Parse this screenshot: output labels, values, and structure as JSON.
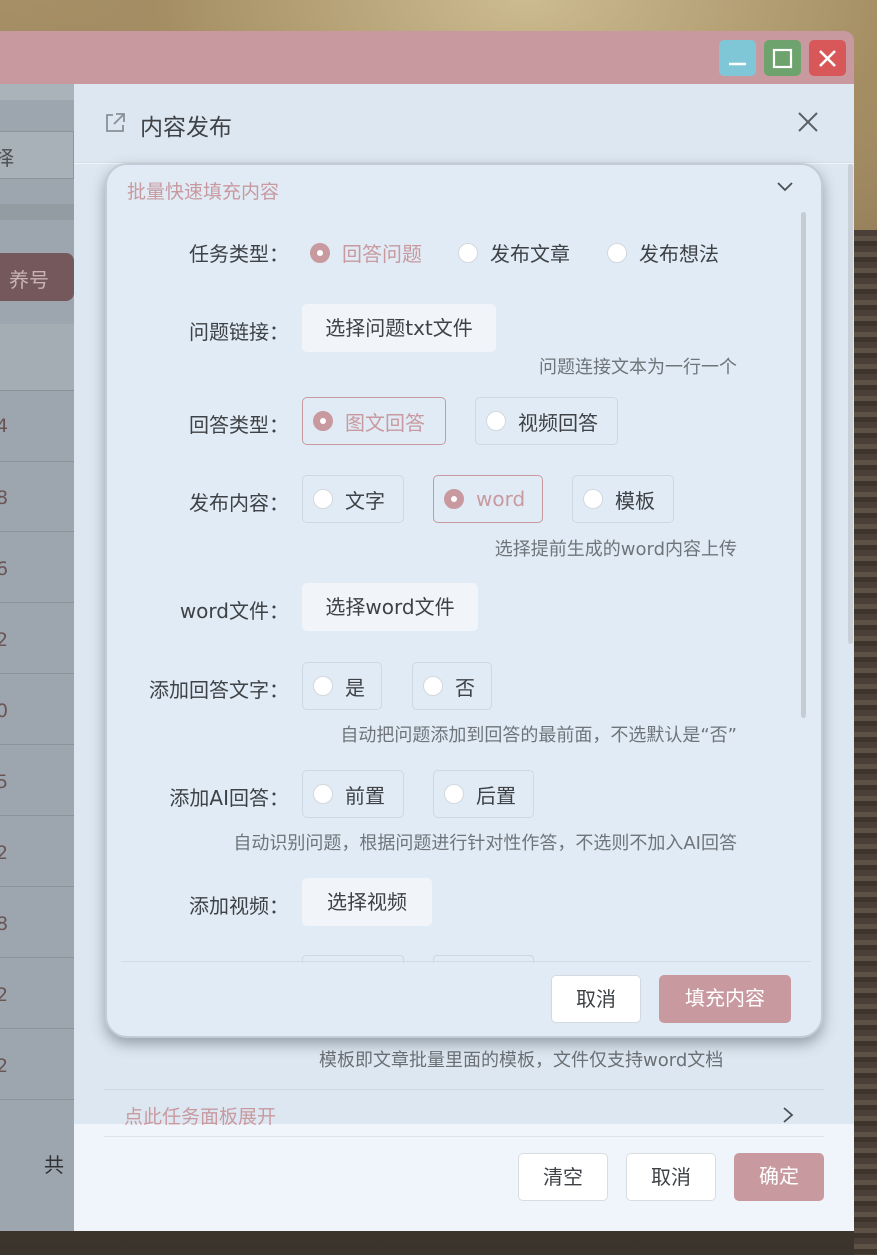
{
  "window_controls": {
    "minimize": "minimize",
    "maximize": "maximize",
    "close": "close"
  },
  "background_app": {
    "select_partial": "择",
    "tag_partial": "养号",
    "row_values": [
      "4",
      "8",
      "6",
      "2",
      "0",
      "5",
      "2",
      "8",
      "2",
      "2"
    ],
    "total_partial": "共"
  },
  "panel": {
    "title": "内容发布",
    "template_hint": "模板即文章批量里面的模板，文件仅支持word文档",
    "expand_label": "点此任务面板展开",
    "buttons": {
      "clear": "清空",
      "cancel": "取消",
      "confirm": "确定"
    }
  },
  "card": {
    "title": "批量快速填充内容",
    "task_type": {
      "label": "任务类型：",
      "options": [
        {
          "label": "回答问题",
          "checked": true
        },
        {
          "label": "发布文章",
          "checked": false
        },
        {
          "label": "发布想法",
          "checked": false
        }
      ]
    },
    "question_link": {
      "label": "问题链接：",
      "button": "选择问题txt文件",
      "hint": "问题连接文本为一行一个"
    },
    "answer_type": {
      "label": "回答类型：",
      "options": [
        {
          "label": "图文回答",
          "checked": true
        },
        {
          "label": "视频回答",
          "checked": false
        }
      ]
    },
    "publish_content": {
      "label": "发布内容：",
      "options": [
        {
          "label": "文字",
          "checked": false
        },
        {
          "label": "word",
          "checked": true
        },
        {
          "label": "模板",
          "checked": false
        }
      ],
      "hint": "选择提前生成的word内容上传"
    },
    "word_file": {
      "label": "word文件：",
      "button": "选择word文件"
    },
    "add_answer_text": {
      "label": "添加回答文字：",
      "options": [
        {
          "label": "是",
          "checked": false
        },
        {
          "label": "否",
          "checked": false
        }
      ],
      "hint": "自动把问题添加到回答的最前面，不选默认是“否”"
    },
    "add_ai_answer": {
      "label": "添加AI回答：",
      "options": [
        {
          "label": "前置",
          "checked": false
        },
        {
          "label": "后置",
          "checked": false
        }
      ],
      "hint": "自动识别问题，根据问题进行针对性作答，不选则不加入AI回答"
    },
    "add_video": {
      "label": "添加视频：",
      "button": "选择视频"
    },
    "buttons": {
      "cancel": "取消",
      "fill": "填充内容"
    }
  },
  "colors": {
    "accent": "#c89aa0",
    "titlebar": "#c89aa0",
    "minimize": "#7fc6d6",
    "maximize": "#6ea36d",
    "close": "#d8585a"
  },
  "icons": [
    "minimize-icon",
    "maximize-icon",
    "close-icon",
    "external-link-icon",
    "chevron-down-icon",
    "chevron-right-icon"
  ]
}
